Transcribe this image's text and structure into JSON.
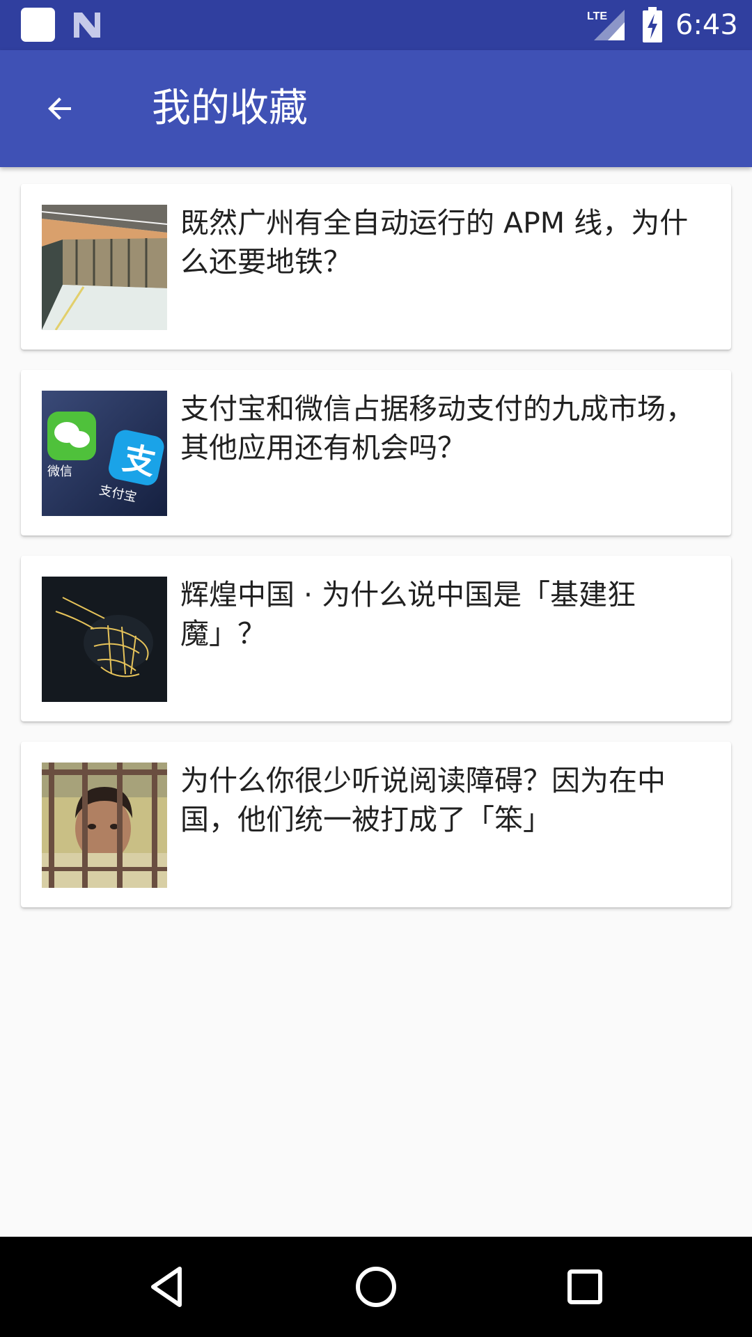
{
  "status_bar": {
    "time": "6:43",
    "network_label": "LTE",
    "icons": [
      "app-notification-icon",
      "n-notification-icon",
      "lte-signal-icon",
      "battery-charging-icon"
    ]
  },
  "app_bar": {
    "title": "我的收藏",
    "back_icon": "arrow-back-icon",
    "color": "#3f51b5",
    "status_color": "#303f9f"
  },
  "favorites": [
    {
      "title": "既然广州有全自动运行的 APM 线，为什么还要地铁？",
      "thumbnail": "subway-platform-photo"
    },
    {
      "title": "支付宝和微信占据移动支付的九成市场，其他应用还有机会吗？",
      "thumbnail": "wechat-alipay-photo",
      "thumb_labels": [
        "微信",
        "支付宝",
        "支"
      ]
    },
    {
      "title": "辉煌中国 · 为什么说中国是「基建狂魔」？",
      "thumbnail": "china-night-map-photo"
    },
    {
      "title": "为什么你很少听说阅读障碍？因为在中国，他们统一被打成了「笨」",
      "thumbnail": "boy-behind-bars-photo"
    }
  ],
  "nav_bar": {
    "icons": [
      "back-triangle-icon",
      "home-circle-icon",
      "recents-square-icon"
    ]
  }
}
